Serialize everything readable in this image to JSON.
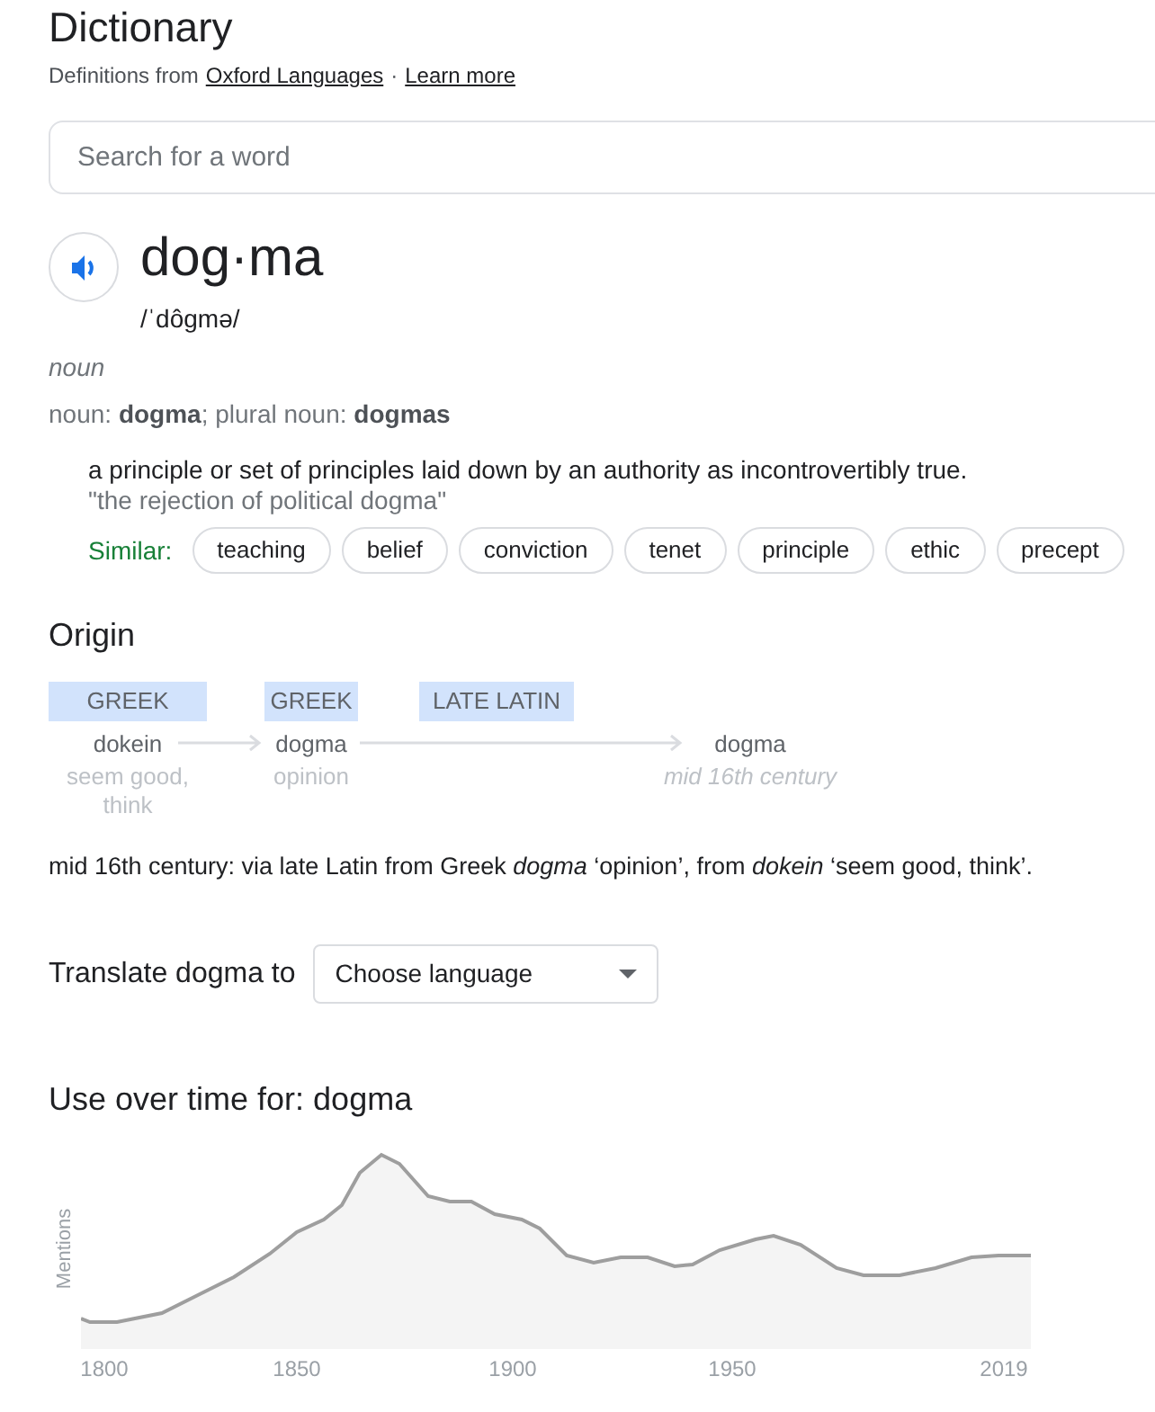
{
  "header": {
    "title": "Dictionary",
    "source_prefix": "Definitions from",
    "source_link": "Oxford Languages",
    "separator": "·",
    "learn_more": "Learn more"
  },
  "search": {
    "placeholder": "Search for a word"
  },
  "entry": {
    "headword": "dog·ma",
    "pronunciation": "/ˈdôɡmə/",
    "part_of_speech": "noun",
    "forms": "noun: **dogma**; plural noun: **dogmas**",
    "definition": "a principle or set of principles laid down by an authority as incontrovertibly true.",
    "example": "\"the rejection of political dogma\"",
    "similar_label": "Similar:",
    "similar": [
      "teaching",
      "belief",
      "conviction",
      "tenet",
      "principle",
      "ethic",
      "precept"
    ]
  },
  "origin": {
    "title": "Origin",
    "languages": [
      "GREEK",
      "GREEK",
      "LATE LATIN"
    ],
    "words": [
      {
        "word": "dokein",
        "gloss": "seem good, think",
        "kind": "source"
      },
      {
        "word": "dogma",
        "gloss": "opinion",
        "kind": "source"
      },
      {
        "word": "dogma",
        "gloss": "mid 16th century",
        "kind": "result"
      }
    ],
    "text": "mid 16th century: via late Latin from Greek *dogma* ‘opinion’, from *dokein* ‘seem good, think’."
  },
  "translate": {
    "label": "Translate dogma to",
    "select": "Choose language"
  },
  "usage": {
    "title": "Use over time for: dogma",
    "ylabel": "Mentions",
    "x_labels": [
      "1800",
      "1850",
      "1900",
      "1950",
      "2019"
    ]
  }
}
